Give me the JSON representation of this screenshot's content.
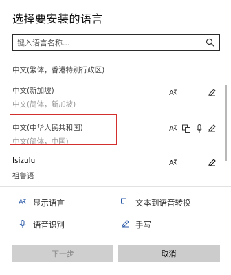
{
  "dialog": {
    "title": "选择要安装的语言",
    "search": {
      "placeholder": "键入语言名称..."
    }
  },
  "languages": [
    {
      "name": "中文(繁体，香港特别行政区)",
      "sub": "",
      "features": []
    },
    {
      "name": "中文(新加坡)",
      "sub": "中文(简体，新加坡)",
      "features": [
        "display-language",
        "handwriting"
      ]
    },
    {
      "name": "中文(中华人民共和国)",
      "sub": "中文(简体，中国)",
      "features": [
        "display-language",
        "text-to-speech",
        "speech",
        "handwriting"
      ],
      "highlighted": true
    },
    {
      "name": "Isizulu",
      "sub": "祖鲁语",
      "features": [
        "display-language",
        "handwriting"
      ]
    }
  ],
  "legend": {
    "display_language": "显示语言",
    "text_to_speech": "文本到语音转换",
    "speech": "语音识别",
    "handwriting": "手写"
  },
  "buttons": {
    "next": "下一步",
    "cancel": "取消"
  },
  "colors": {
    "highlight": "#d32f2f",
    "icon": "#2b5aa8",
    "button_bg": "#cccccc"
  }
}
